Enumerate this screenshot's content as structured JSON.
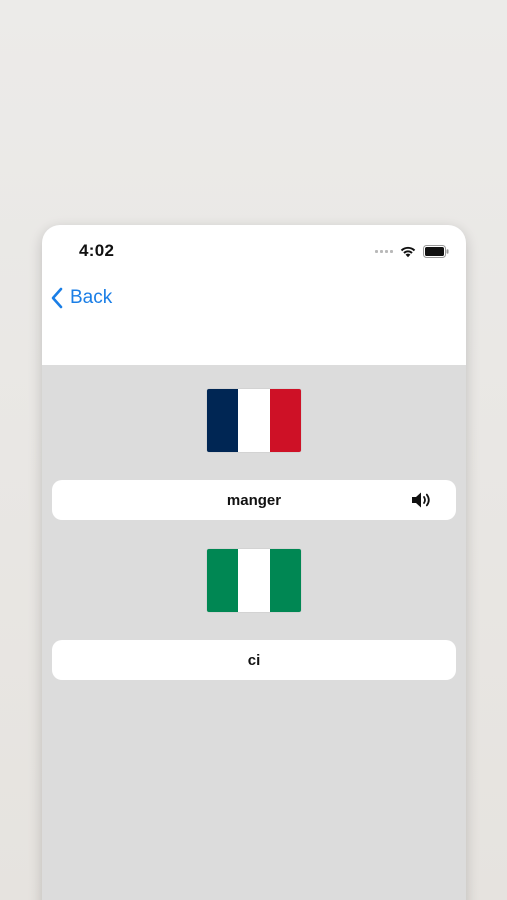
{
  "status_bar": {
    "time": "4:02",
    "icons": [
      "cellular-signal-icon",
      "wifi-icon",
      "battery-icon"
    ]
  },
  "nav": {
    "back_label": "Back",
    "back_icon": "chevron-left-icon",
    "accent_color": "#1a7ee6"
  },
  "cards": [
    {
      "flag": "france-flag",
      "flag_colors": [
        "#002654",
        "#ffffff",
        "#ce1126"
      ],
      "word": "manger",
      "has_audio": true,
      "audio_icon": "speaker-icon"
    },
    {
      "flag": "nigeria-flag",
      "flag_colors": [
        "#008753",
        "#ffffff",
        "#008753"
      ],
      "word": "ci",
      "has_audio": false
    }
  ]
}
